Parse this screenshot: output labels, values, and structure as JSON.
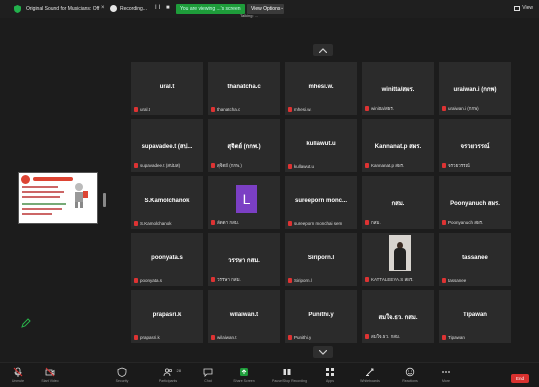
{
  "topbar": {
    "sound_label": "Original Sound for Musicians: Off",
    "sound_close": "×",
    "recording_label": "Recording...",
    "recording_controls": "II ■",
    "viewing_banner": "You are viewing ...'s screen",
    "view_options": "View Options",
    "view_options_caret": "⌄",
    "talking": "Talking: ...",
    "view_label": "View"
  },
  "participants": [
    {
      "name": "ural.t",
      "label": "ural.t"
    },
    {
      "name": "thanatcha.c",
      "label": "thanatcha.c"
    },
    {
      "name": "mhesi.w.",
      "label": "mhesi.w."
    },
    {
      "name": "winitta/สผร.",
      "label": "winitta/สผร."
    },
    {
      "name": "uraiwan.i (กกพ)",
      "label": "uraiwan.i (กกพ)"
    },
    {
      "name": "supavadee.t (สป...",
      "label": "supavadee.t (สปมส)"
    },
    {
      "name": "สุจิตย์ (กกพ.)",
      "label": "สุจิตย์ (กกพ.)"
    },
    {
      "name": "kullawut.u",
      "label": "kullawut.u"
    },
    {
      "name": "Kannanat.p สผร.",
      "label": "Kannanat.p สผร."
    },
    {
      "name": "จรวยวรรณ์",
      "label": "จรวยวรรณ์"
    },
    {
      "name": "S.Kamolchanok",
      "label": "S.Kamolchanok"
    },
    {
      "name": "",
      "label": "ลัดดา กสม.",
      "avatar": "L"
    },
    {
      "name": "sureeporn monc...",
      "label": "sureeporn monchai sem"
    },
    {
      "name": "กสม.",
      "label": "กสม."
    },
    {
      "name": "Poonyanuch สผร.",
      "label": "Poonyanuch สผร."
    },
    {
      "name": "poonyata.s",
      "label": "poonyata.s"
    },
    {
      "name": "วรรษา กสม.",
      "label": "วรรษา กสม."
    },
    {
      "name": "Siriporn.l",
      "label": "Siriporn.l"
    },
    {
      "name": "",
      "label": "KATTALEEYA.S สผร.",
      "photo": true
    },
    {
      "name": "tassanee",
      "label": "tassanee"
    },
    {
      "name": "prapasri.k",
      "label": "prapasri.k"
    },
    {
      "name": "wilaiwan.t",
      "label": "wilaiwan.t"
    },
    {
      "name": "Punithi.y",
      "label": "Punithi.y"
    },
    {
      "name": "สมใจ.ธว. กสม.",
      "label": "สมใจ.ธว. กสม."
    },
    {
      "name": "Tipawan",
      "label": "Tipawan"
    }
  ],
  "toolbar": {
    "items": [
      {
        "name": "mute",
        "cap": "Unmute"
      },
      {
        "name": "video",
        "cap": "Start Video"
      },
      {
        "name": "security",
        "cap": "Security"
      },
      {
        "name": "participants",
        "cap": "Participants",
        "badge": "28"
      },
      {
        "name": "chat",
        "cap": "Chat"
      },
      {
        "name": "share",
        "cap": "Share Screen"
      },
      {
        "name": "record",
        "cap": "Pause/Stop Recording"
      },
      {
        "name": "apps",
        "cap": "Apps"
      },
      {
        "name": "whiteboards",
        "cap": "Whiteboards"
      },
      {
        "name": "reactions",
        "cap": "Reactions"
      },
      {
        "name": "more",
        "cap": "More"
      }
    ],
    "end_label": "End"
  },
  "colors": {
    "tile": "#2b2b2b",
    "banner_green": "#1e9c3a",
    "end_red": "#d9312f",
    "avatar_purple": "#7b3fc4"
  }
}
